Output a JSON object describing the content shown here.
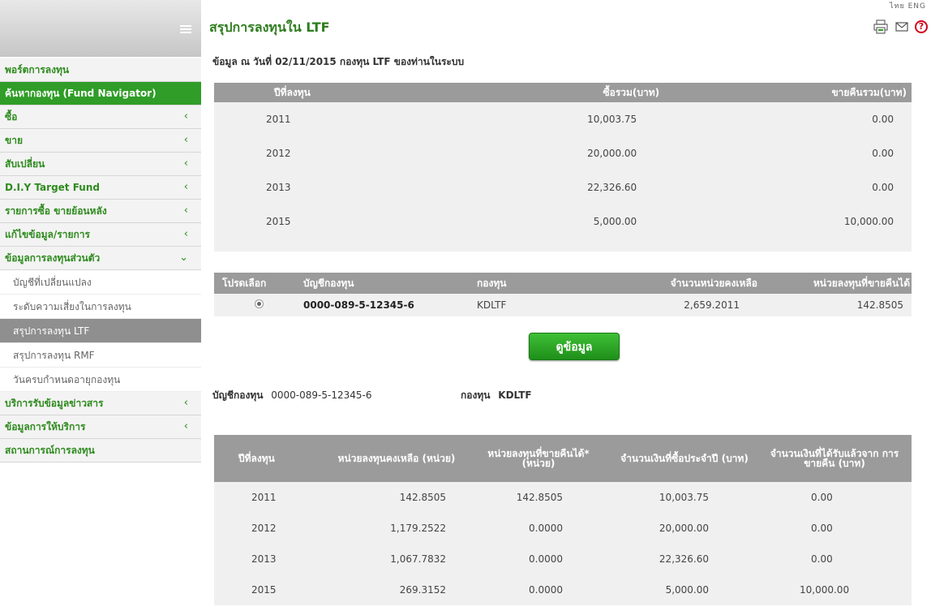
{
  "lang": "ไทย ENG",
  "page_title": "สรุปการลงทุนใน LTF",
  "info_line": "ข้อมูล ณ วันที่ 02/11/2015 กองทุน LTF ของท่านในระบบ",
  "sidebar": {
    "items": [
      {
        "label": "พอร์ตการลงทุน",
        "chevron": ""
      },
      {
        "label": "ค้นหากองทุน (Fund Navigator)",
        "chevron": ""
      },
      {
        "label": "ซื้อ",
        "chevron": "‹"
      },
      {
        "label": "ขาย",
        "chevron": "‹"
      },
      {
        "label": "สับเปลี่ยน",
        "chevron": "‹"
      },
      {
        "label": "D.I.Y Target Fund",
        "chevron": "‹"
      },
      {
        "label": "รายการซื้อ ขายย้อนหลัง",
        "chevron": "‹"
      },
      {
        "label": "แก้ไขข้อมูล/รายการ",
        "chevron": "‹"
      },
      {
        "label": "ข้อมูลการลงทุนส่วนตัว",
        "chevron": "⌄"
      }
    ],
    "subitems": [
      {
        "label": "บัญชีที่เปลี่ยนแปลง"
      },
      {
        "label": "ระดับความเสี่ยงในการลงทุน"
      },
      {
        "label": "สรุปการลงทุน LTF"
      },
      {
        "label": "สรุปการลงทุน RMF"
      },
      {
        "label": "วันครบกำหนดอายุกองทุน"
      }
    ],
    "bottom_items": [
      {
        "label": "บริการรับข้อมูลข่าวสาร",
        "chevron": "‹"
      },
      {
        "label": "ข้อมูลการให้บริการ",
        "chevron": "‹"
      },
      {
        "label": "สถานการณ์การลงทุน",
        "chevron": ""
      }
    ]
  },
  "summary_table": {
    "headers": [
      "ปีที่ลงทุน",
      "ซื้อรวม(บาท)",
      "ขายคืนรวม(บาท)"
    ],
    "rows": [
      [
        "2011",
        "10,003.75",
        "0.00"
      ],
      [
        "2012",
        "20,000.00",
        "0.00"
      ],
      [
        "2013",
        "22,326.60",
        "0.00"
      ],
      [
        "2015",
        "5,000.00",
        "10,000.00"
      ]
    ]
  },
  "select_table": {
    "headers": [
      "โปรดเลือก",
      "บัญชีกองทุน",
      "กองทุน",
      "จำนวนหน่วยคงเหลือ",
      "หน่วยลงทุนที่ขายคืนได้"
    ],
    "rows": [
      [
        "0000-089-5-12345-6",
        "KDLTF",
        "2,659.2011",
        "142.8505"
      ]
    ]
  },
  "view_button": "ดูข้อมูล",
  "account": {
    "label": "บัญชีกองทุน",
    "value": "0000-089-5-12345-6"
  },
  "fund": {
    "label": "กองทุน",
    "value": "KDLTF"
  },
  "detail_table": {
    "headers": [
      "ปีที่ลงทุน",
      "หน่วยลงทุนคงเหลือ (หน่วย)",
      "หน่วยลงทุนที่ขายคืนได้* (หน่วย)",
      "จำนวนเงินที่ซื้อประจำปี (บาท)",
      "จำนวนเงินที่ได้รับแล้วจาก การขายคืน (บาท)"
    ],
    "rows": [
      [
        "2011",
        "142.8505",
        "142.8505",
        "10,003.75",
        "0.00"
      ],
      [
        "2012",
        "1,179.2522",
        "0.0000",
        "20,000.00",
        "0.00"
      ],
      [
        "2013",
        "1,067.7832",
        "0.0000",
        "22,326.60",
        "0.00"
      ],
      [
        "2015",
        "269.3152",
        "0.0000",
        "5,000.00",
        "10,000.00"
      ]
    ]
  },
  "icons": {
    "print": "print-icon",
    "mail": "mail-icon",
    "help": "help-icon"
  },
  "colors": {
    "accent_green": "#2f9d27",
    "title_green": "#2e7d1e",
    "header_gray": "#9b9b9b"
  }
}
